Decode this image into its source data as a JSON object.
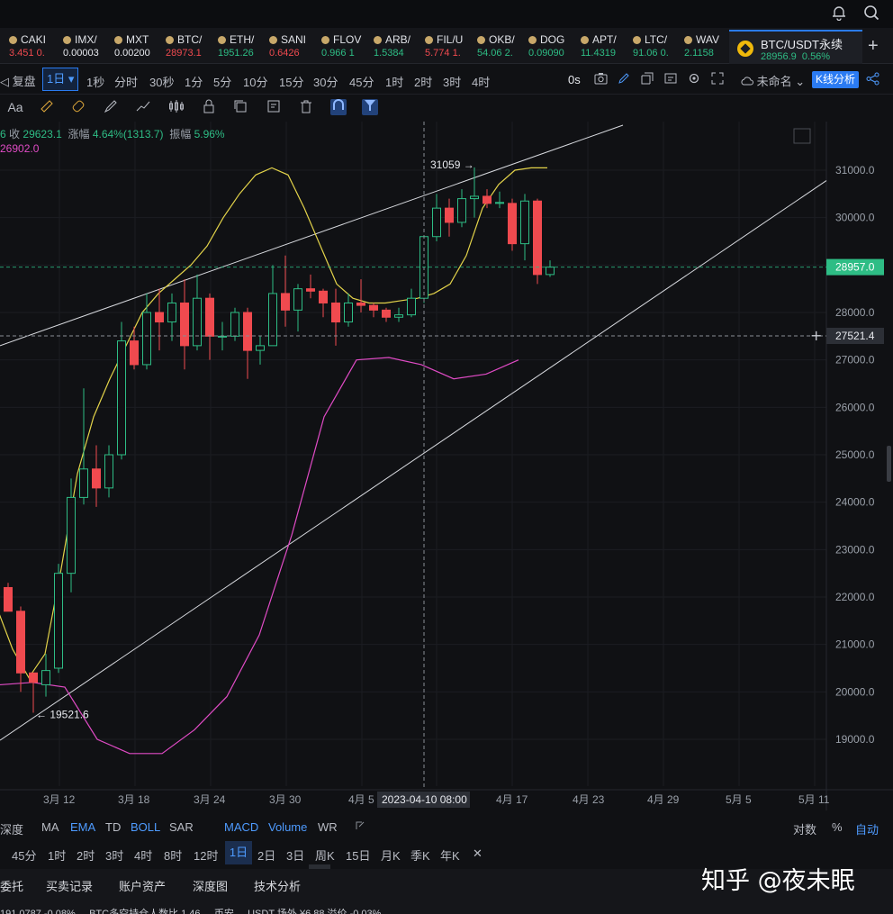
{
  "topbar": {
    "bell_icon": "bell-icon",
    "search_icon": "search-icon"
  },
  "tickers": [
    {
      "sym": "CAKI",
      "val": "3.451  0.",
      "dir": "dn",
      "left": 10
    },
    {
      "sym": "IMX/",
      "val": "0.00003",
      "dir": "wh",
      "left": 70
    },
    {
      "sym": "MXT",
      "val": "0.00200",
      "dir": "wh",
      "left": 127
    },
    {
      "sym": "BTC/",
      "val": "28973.1",
      "dir": "dn",
      "left": 184
    },
    {
      "sym": "ETH/",
      "val": "1951.26",
      "dir": "up",
      "left": 242
    },
    {
      "sym": "SANI",
      "val": "0.6426",
      "dir": "dn",
      "left": 299
    },
    {
      "sym": "FLOV",
      "val": "0.966  1",
      "dir": "up",
      "left": 357
    },
    {
      "sym": "ARB/",
      "val": "1.5384",
      "dir": "up",
      "left": 415
    },
    {
      "sym": "FIL/U",
      "val": "5.774  1.",
      "dir": "dn",
      "left": 472
    },
    {
      "sym": "OKB/",
      "val": "54.06  2.",
      "dir": "up",
      "left": 530
    },
    {
      "sym": "DOG",
      "val": "0.09090",
      "dir": "up",
      "left": 587
    },
    {
      "sym": "APT/",
      "val": "11.4319",
      "dir": "up",
      "left": 645
    },
    {
      "sym": "LTC/",
      "val": "91.06  0.",
      "dir": "up",
      "left": 703
    },
    {
      "sym": "WAV",
      "val": "2.1158",
      "dir": "up",
      "left": 760
    }
  ],
  "active_tab": {
    "name": "BTC/USDT永续",
    "price": "28956.9",
    "change": "0.56%"
  },
  "toolbar": {
    "replay": "复盘",
    "interval_active": "1日",
    "intervals": [
      "1秒",
      "分时",
      "30秒",
      "1分",
      "5分",
      "10分",
      "15分",
      "30分",
      "45分",
      "1时",
      "2时",
      "3时",
      "4时"
    ],
    "countdown": "0s",
    "layout_name": "未命名",
    "kline_analysis": "K线分析"
  },
  "legend": {
    "prefix": "6",
    "close_label": "收",
    "close": "29623.1",
    "change_label": "涨幅",
    "change": "4.64%(1313.7)",
    "amp_label": "振幅",
    "amp": "5.96%",
    "line2": "26902.0"
  },
  "chart_data": {
    "type": "candlestick",
    "ylim": [
      18300,
      31800
    ],
    "yticks": [
      19000,
      20000,
      21000,
      22000,
      23000,
      24000,
      25000,
      26000,
      27000,
      28000,
      29000,
      30000,
      31000
    ],
    "ytick_labels": [
      "19000.0",
      "20000.0",
      "21000.0",
      "22000.0",
      "23000.0",
      "24000.0",
      "25000.0",
      "26000.0",
      "27000.0",
      "28000.0",
      "29000.0",
      "30000.0",
      "31000.0"
    ],
    "x_labels": [
      "3月 12",
      "3月 18",
      "3月 24",
      "3月 30",
      "4月 5",
      "4月 17",
      "4月 23",
      "4月 29",
      "5月 5",
      "5月 11"
    ],
    "crosshair_date": "2023-04-10 08:00",
    "current_price": "28957.0",
    "crosshair_price": "27521.4",
    "high_label": "31059",
    "low_label": "19521.6",
    "candles": [
      {
        "d": "3/8",
        "o": 22200,
        "h": 22300,
        "l": 21900,
        "c": 21700
      },
      {
        "d": "3/9",
        "o": 21700,
        "h": 21800,
        "l": 20000,
        "c": 20400
      },
      {
        "d": "3/10",
        "o": 20400,
        "h": 20400,
        "l": 19560,
        "c": 20200
      },
      {
        "d": "3/11",
        "o": 20150,
        "h": 20800,
        "l": 19900,
        "c": 20450
      },
      {
        "d": "3/12",
        "o": 20500,
        "h": 22700,
        "l": 20400,
        "c": 22500
      },
      {
        "d": "3/13",
        "o": 22500,
        "h": 24500,
        "l": 22100,
        "c": 24100
      },
      {
        "d": "3/14",
        "o": 24100,
        "h": 26400,
        "l": 23950,
        "c": 24700
      },
      {
        "d": "3/15",
        "o": 24700,
        "h": 25200,
        "l": 23900,
        "c": 24300
      },
      {
        "d": "3/16",
        "o": 24300,
        "h": 25200,
        "l": 24100,
        "c": 25000
      },
      {
        "d": "3/17",
        "o": 25000,
        "h": 27800,
        "l": 24900,
        "c": 27400
      },
      {
        "d": "3/18",
        "o": 27400,
        "h": 27700,
        "l": 26800,
        "c": 26900
      },
      {
        "d": "3/19",
        "o": 26900,
        "h": 28400,
        "l": 26800,
        "c": 28000
      },
      {
        "d": "3/20",
        "o": 28000,
        "h": 28500,
        "l": 27200,
        "c": 27800
      },
      {
        "d": "3/21",
        "o": 27800,
        "h": 28400,
        "l": 27400,
        "c": 28200
      },
      {
        "d": "3/22",
        "o": 28200,
        "h": 28700,
        "l": 26800,
        "c": 27300
      },
      {
        "d": "3/23",
        "o": 27300,
        "h": 28800,
        "l": 27200,
        "c": 28300
      },
      {
        "d": "3/24",
        "o": 28300,
        "h": 28400,
        "l": 27000,
        "c": 27500
      },
      {
        "d": "3/25",
        "o": 27500,
        "h": 27800,
        "l": 27200,
        "c": 27500
      },
      {
        "d": "3/26",
        "o": 27500,
        "h": 28100,
        "l": 27400,
        "c": 28000
      },
      {
        "d": "3/27",
        "o": 28000,
        "h": 28100,
        "l": 26600,
        "c": 27200
      },
      {
        "d": "3/28",
        "o": 27200,
        "h": 27500,
        "l": 26900,
        "c": 27300
      },
      {
        "d": "3/29",
        "o": 27300,
        "h": 29000,
        "l": 27300,
        "c": 28400
      },
      {
        "d": "3/30",
        "o": 28400,
        "h": 29200,
        "l": 27700,
        "c": 28050
      },
      {
        "d": "3/31",
        "o": 28050,
        "h": 28600,
        "l": 27600,
        "c": 28500
      },
      {
        "d": "4/1",
        "o": 28500,
        "h": 28800,
        "l": 28300,
        "c": 28450
      },
      {
        "d": "4/2",
        "o": 28450,
        "h": 28500,
        "l": 27900,
        "c": 28200
      },
      {
        "d": "4/3",
        "o": 28200,
        "h": 28500,
        "l": 27300,
        "c": 27800
      },
      {
        "d": "4/4",
        "o": 27800,
        "h": 28400,
        "l": 27700,
        "c": 28200
      },
      {
        "d": "4/5",
        "o": 28200,
        "h": 28700,
        "l": 28000,
        "c": 28150
      },
      {
        "d": "4/6",
        "o": 28150,
        "h": 28200,
        "l": 27900,
        "c": 28050
      },
      {
        "d": "4/7",
        "o": 28050,
        "h": 28100,
        "l": 27800,
        "c": 27900
      },
      {
        "d": "4/8",
        "o": 27900,
        "h": 28100,
        "l": 27800,
        "c": 27950
      },
      {
        "d": "4/9",
        "o": 27950,
        "h": 28500,
        "l": 27900,
        "c": 28300
      },
      {
        "d": "4/10",
        "o": 28300,
        "h": 29500,
        "l": 28200,
        "c": 29600
      },
      {
        "d": "4/11",
        "o": 29600,
        "h": 30500,
        "l": 29500,
        "c": 30200
      },
      {
        "d": "4/12",
        "o": 30200,
        "h": 30400,
        "l": 29600,
        "c": 29900
      },
      {
        "d": "4/13",
        "o": 29900,
        "h": 30600,
        "l": 29800,
        "c": 30400
      },
      {
        "d": "4/14",
        "o": 30400,
        "h": 31059,
        "l": 30000,
        "c": 30450
      },
      {
        "d": "4/15",
        "o": 30450,
        "h": 30600,
        "l": 30200,
        "c": 30300
      },
      {
        "d": "4/16",
        "o": 30300,
        "h": 30550,
        "l": 30200,
        "c": 30320
      },
      {
        "d": "4/17",
        "o": 30300,
        "h": 30400,
        "l": 29300,
        "c": 29450
      },
      {
        "d": "4/18",
        "o": 29450,
        "h": 30500,
        "l": 29100,
        "c": 30350
      },
      {
        "d": "4/19",
        "o": 30350,
        "h": 30400,
        "l": 28600,
        "c": 28800
      },
      {
        "d": "4/20",
        "o": 28800,
        "h": 29100,
        "l": 28750,
        "c": 28957
      }
    ],
    "series": [
      {
        "name": "",
        "color": "#e3d34a",
        "values": [
          21800,
          20900,
          20300,
          20800,
          22600,
          24600,
          25800,
          26600,
          27300,
          28000,
          28400,
          28700,
          29000,
          29400,
          30000,
          30500,
          30900,
          31050,
          30900,
          30200,
          29400,
          28600,
          28300,
          28200,
          28200,
          28250,
          28300,
          28400,
          28600,
          29200,
          30200,
          30700,
          31000,
          31050,
          31050
        ]
      },
      {
        "name": "",
        "color": "#e04bc5",
        "values": [
          20150,
          20200,
          20100,
          19000,
          18700,
          18700,
          19200,
          19900,
          21200,
          23300,
          25800,
          27000,
          27050,
          26900,
          26600,
          26700,
          27000
        ]
      }
    ]
  },
  "indicators": {
    "depth": "深度",
    "items": [
      "MA",
      "EMA",
      "TD",
      "BOLL",
      "SAR",
      "MACD",
      "Volume",
      "WR"
    ],
    "right": [
      "对数",
      "%",
      "自动"
    ]
  },
  "periods": [
    "45分",
    "1时",
    "2时",
    "3时",
    "4时",
    "8时",
    "12时",
    "1日",
    "2日",
    "3日",
    "周K",
    "15日",
    "月K",
    "季K",
    "年K"
  ],
  "bottom_tabs": [
    "委托",
    "买卖记录",
    "账户资产",
    "深度图",
    "技术分析"
  ],
  "watermark": "知乎 @夜未眠",
  "bottom_ticker": "191.0787  -0.08%       ...  BTC多空持仓人数比  1.46  ... 币安 ...  USDT  场外  ¥6.88  溢价  -0.03%"
}
